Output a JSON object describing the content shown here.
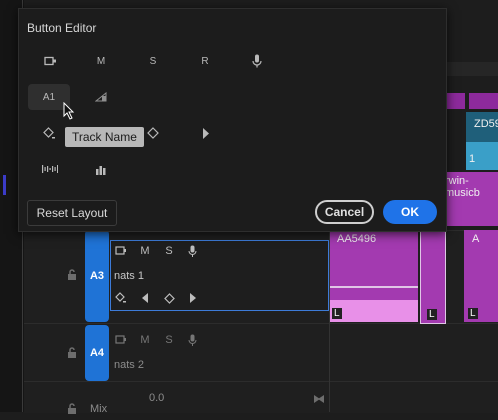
{
  "dialog": {
    "title": "Button Editor",
    "tooltip": "Track Name",
    "buttons": {
      "reset": "Reset Layout",
      "cancel": "Cancel",
      "ok": "OK"
    },
    "row1": {
      "m": "M",
      "s": "S",
      "r": "R"
    },
    "row2": {
      "a1": "A1"
    }
  },
  "tracks": [
    {
      "id": "A3",
      "name": "nats 1",
      "m": "M",
      "s": "S"
    },
    {
      "id": "A4",
      "name": "nats 2",
      "m": "M",
      "s": "S"
    }
  ],
  "mix": {
    "label": "Mix",
    "value": "0.0"
  },
  "clips": {
    "zd": "ZD59",
    "num": "1",
    "erwin": "rwin-musicb",
    "aa": "AA5496",
    "a_dot": "A",
    "l1": "L",
    "l2": "L",
    "l3": "L"
  },
  "colors": {
    "accent": "#1f73e8",
    "track_blue": "#1f73d6",
    "clip_purple": "#a33ab0",
    "clip_pink": "#e890e8",
    "clip_cyan": "#3a9fc8"
  }
}
